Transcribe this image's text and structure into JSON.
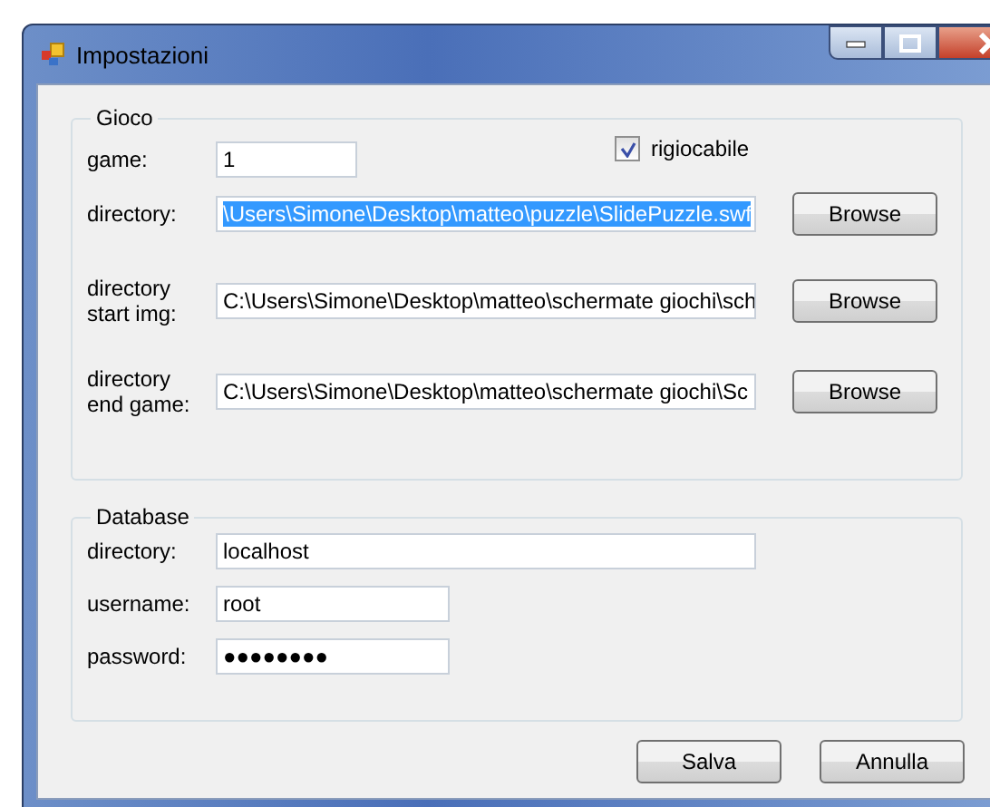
{
  "window": {
    "title": "Impostazioni"
  },
  "gioco": {
    "legend": "Gioco",
    "game": {
      "label": "game:",
      "value": "1"
    },
    "replayable": {
      "label": "rigiocabile",
      "checked": true
    },
    "rows": [
      {
        "label": "directory:",
        "value": "\\Users\\Simone\\Desktop\\matteo\\puzzle\\SlidePuzzle.swf",
        "selected": true,
        "button": "Browse"
      },
      {
        "label": "directory start img:",
        "value": "C:\\Users\\Simone\\Desktop\\matteo\\schermate giochi\\sch",
        "selected": false,
        "button": "Browse"
      },
      {
        "label": "directory end game:",
        "value": "C:\\Users\\Simone\\Desktop\\matteo\\schermate giochi\\Sc",
        "selected": false,
        "button": "Browse"
      }
    ]
  },
  "database": {
    "legend": "Database",
    "fields": [
      {
        "label": "directory:",
        "value": "localhost",
        "kind": "wide"
      },
      {
        "label": "username:",
        "value": "root",
        "kind": "short"
      },
      {
        "label": "password:",
        "value": "●●●●●●●●",
        "kind": "short"
      }
    ]
  },
  "buttons": [
    "Salva",
    "Annulla"
  ]
}
